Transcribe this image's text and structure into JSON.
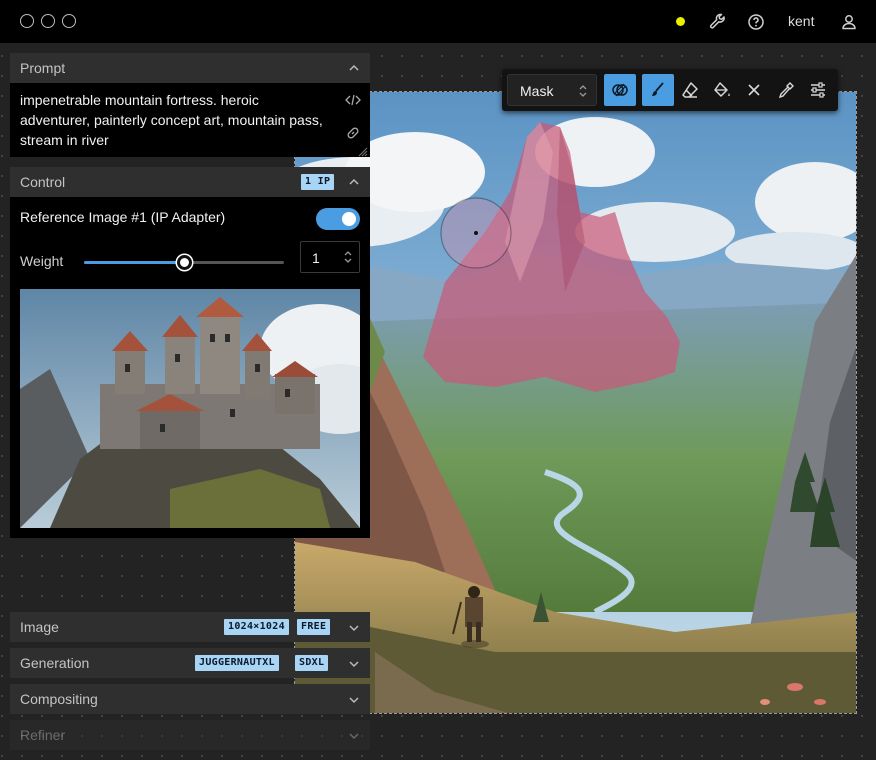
{
  "window": {
    "controls": [
      "close",
      "minimize",
      "maximize"
    ],
    "username": "kent",
    "status_color": "#e8f000",
    "icons": [
      "wrench-icon",
      "help-icon",
      "user-icon"
    ]
  },
  "prompt": {
    "title": "Prompt",
    "text": "impenetrable mountain fortress. heroic adventurer, painterly concept art, mountain pass, stream in river"
  },
  "control": {
    "title": "Control",
    "badge": "1 IP",
    "reference_label": "Reference Image #1 (IP Adapter)",
    "enabled": true,
    "weight_label": "Weight",
    "weight_value": "1",
    "weight_slider_fraction": 0.5
  },
  "sections": {
    "image": {
      "title": "Image",
      "badges": [
        "1024×1024",
        "FREE"
      ]
    },
    "generation": {
      "title": "Generation",
      "badges": [
        "JUGGERNAUTXL",
        "SDXL"
      ]
    },
    "compositing": {
      "title": "Compositing"
    },
    "refiner": {
      "title": "Refiner"
    }
  },
  "toolbar": {
    "mode": "Mask",
    "tools": [
      "overlap-icon",
      "brush-icon",
      "eraser-icon",
      "fill-icon",
      "clear-icon",
      "eyedropper-icon",
      "settings-icon"
    ],
    "active_tools": [
      "overlap-icon",
      "brush-icon"
    ]
  },
  "colors": {
    "accent": "#4a9de0",
    "badge_bg": "#a8d4f5",
    "mask": "#c85a78"
  }
}
